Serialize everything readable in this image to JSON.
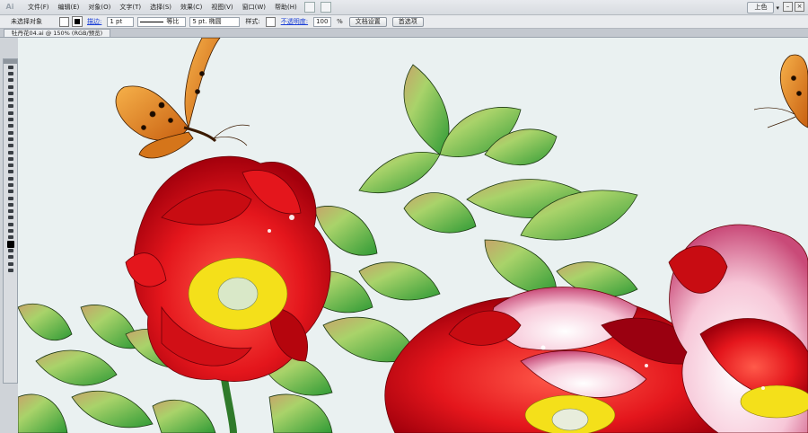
{
  "app": {
    "logo_text": "Ai"
  },
  "menubar": {
    "items": [
      "文件(F)",
      "编辑(E)",
      "对象(O)",
      "文字(T)",
      "选择(S)",
      "效果(C)",
      "视图(V)",
      "窗口(W)",
      "帮助(H)"
    ],
    "workspace_label": "上色",
    "workspace_arrow": "▾"
  },
  "controlbar": {
    "selection_status": "未选择对象",
    "stroke_label": "描边:",
    "stroke_weight": "1 pt",
    "stroke_profile": "等比",
    "brush": "5 pt. 椭圆",
    "style_label": "样式:",
    "opacity_label": "不透明度:",
    "opacity_value": "100",
    "opacity_unit": "%",
    "doc_setup_button": "文档设置",
    "prefs_button": "首选项"
  },
  "document": {
    "tab_title": "牡丹花04.ai @ 150% (RGB/预览)"
  },
  "window_controls": {
    "minimize": "–",
    "restore": "□",
    "close": "×"
  },
  "colors": {
    "canvas_bg": "#eaf1f1",
    "petal_red": "#e4161c",
    "petal_dark": "#a3000c",
    "petal_pink": "#f7c7d8",
    "leaf_green": "#3fa83a",
    "leaf_light": "#a9d36a",
    "stamen_yellow": "#f4e01a",
    "butterfly_orange": "#e8861c"
  },
  "tools": [
    "selection-tool",
    "direct-selection-tool",
    "magic-wand-tool",
    "lasso-tool",
    "pen-tool",
    "type-tool",
    "line-tool",
    "rectangle-tool",
    "paintbrush-tool",
    "pencil-tool",
    "blob-brush-tool",
    "eraser-tool",
    "rotate-tool",
    "scale-tool",
    "warp-tool",
    "free-transform-tool",
    "symbol-sprayer-tool",
    "graph-tool",
    "mesh-tool",
    "gradient-tool",
    "eyedropper-tool",
    "blend-tool",
    "live-paint-tool",
    "artboard-tool",
    "slice-tool",
    "hand-tool",
    "zoom-tool",
    "fill-stroke-swatch",
    "swap-colors",
    "default-colors",
    "color-mode",
    "screen-mode"
  ]
}
